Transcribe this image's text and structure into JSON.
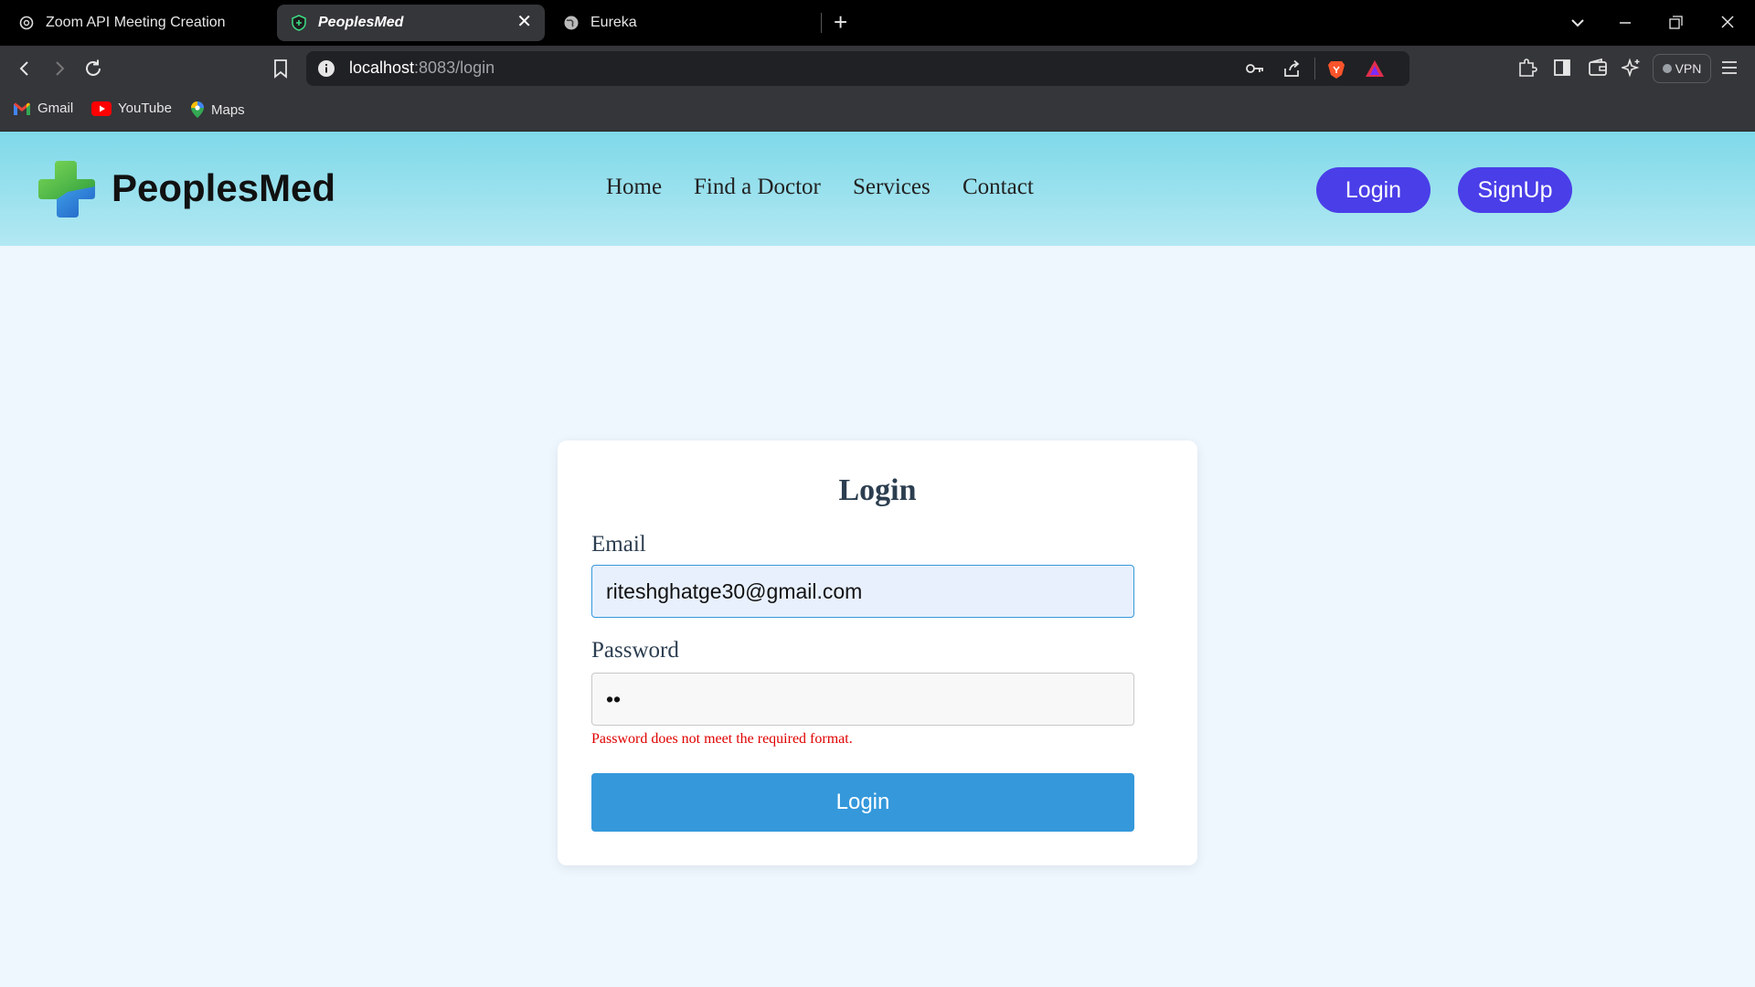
{
  "browser": {
    "tabs": [
      {
        "title": "Zoom API Meeting Creation",
        "icon": "openai-icon"
      },
      {
        "title": "PeoplesMed",
        "icon": "shield-icon",
        "active": true
      },
      {
        "title": "Eureka",
        "icon": "globe-icon"
      }
    ],
    "url_host": "localhost",
    "url_path": ":8083/login",
    "vpn_label": "VPN",
    "bookmarks": [
      {
        "label": "Gmail",
        "icon": "gmail-icon"
      },
      {
        "label": "YouTube",
        "icon": "youtube-icon"
      },
      {
        "label": "Maps",
        "icon": "maps-icon"
      }
    ]
  },
  "header": {
    "brand": "PeoplesMed",
    "nav": [
      "Home",
      "Find a Doctor",
      "Services",
      "Contact"
    ],
    "login_label": "Login",
    "signup_label": "SignUp",
    "accent_color": "#4a3ee8"
  },
  "login": {
    "title": "Login",
    "email_label": "Email",
    "email_value": "riteshghatge30@gmail.com",
    "password_label": "Password",
    "password_value": "••",
    "error_message": "Password does not meet the required format.",
    "submit_label": "Login",
    "submit_color": "#3498db",
    "error_color": "#e00000"
  }
}
